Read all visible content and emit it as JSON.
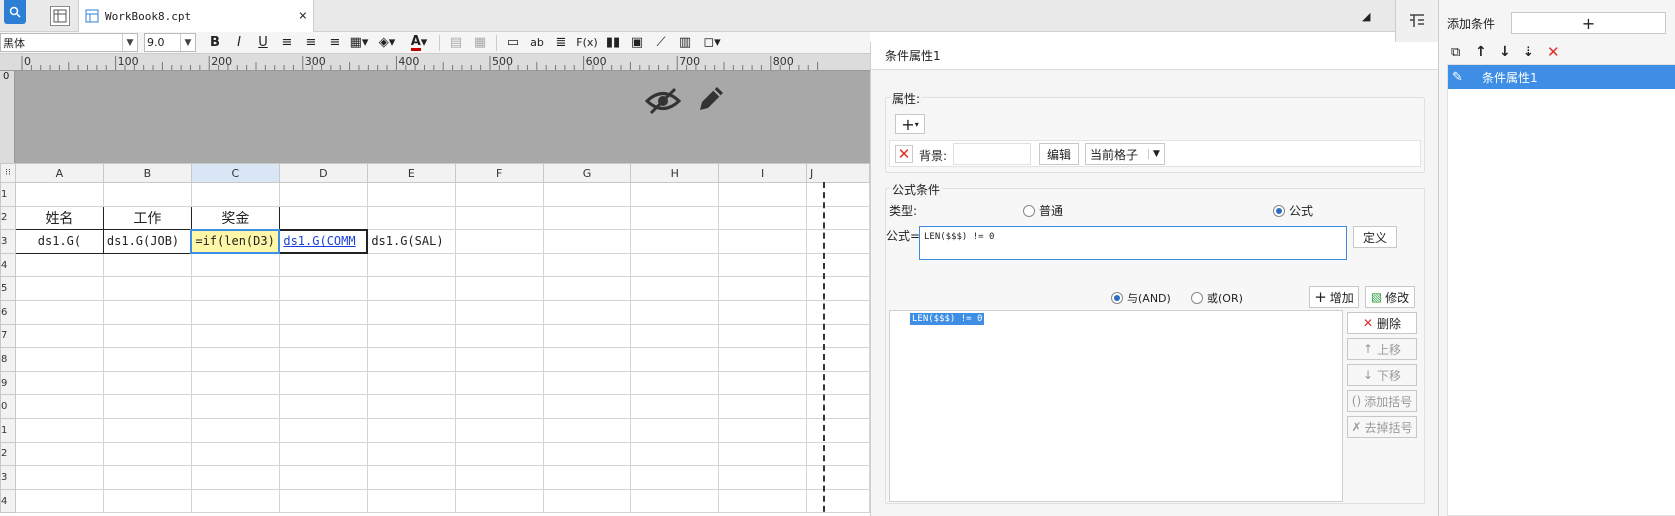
{
  "app": {
    "doc_tab": "WorkBook8.cpt"
  },
  "toolbar": {
    "font_name": "黑体",
    "font_size": "9.0",
    "bold": "B",
    "italic": "I",
    "underline": "U",
    "text_color_glyph": "A",
    "abc_glyph": "ab",
    "fx_glyph": "F(x)"
  },
  "ruler": {
    "ticks": [
      "0",
      "100",
      "200",
      "300",
      "400",
      "500",
      "600",
      "700",
      "800"
    ],
    "left_zero": "0"
  },
  "sheet": {
    "columns": [
      "A",
      "B",
      "C",
      "D",
      "E",
      "F",
      "G",
      "H",
      "I",
      "J"
    ],
    "rows": [
      "1",
      "2",
      "3",
      "4",
      "5",
      "6",
      "7",
      "8",
      "9",
      "0",
      "1",
      "2",
      "3",
      "4"
    ],
    "cells": {
      "A2": "姓名",
      "B2": "工作",
      "C2": "奖金",
      "A3": "ds1.G(",
      "B3": "ds1.G(JOB)",
      "C3": "=if(len(D3)",
      "D3": "ds1.G(COMM",
      "E3": "ds1.G(SAL)"
    }
  },
  "cond_panel": {
    "title": "条件属性1",
    "property_group_label": "属性:",
    "background_label": "背景:",
    "edit_button": "编辑",
    "scope_select": "当前格子",
    "formula_group_label": "公式条件",
    "type_label": "类型:",
    "type_normal": "普通",
    "type_formula": "公式",
    "formula_label": "公式=",
    "formula_value": "LEN($$$) != 0",
    "define_button": "定义",
    "and_label": "与(AND)",
    "or_label": "或(OR)",
    "add_button": "增加",
    "modify_button": "修改",
    "conditions": [
      "LEN($$$) != 0"
    ],
    "delete_button": "删除",
    "up_button": "上移",
    "down_button": "下移",
    "add_paren_button": "添加括号",
    "remove_paren_button": "去掉括号"
  },
  "side_panel": {
    "add_condition_label": "添加条件",
    "items": [
      "条件属性1"
    ]
  },
  "colors": {
    "accent": "#3c8de0",
    "selection": "#3d8ee4",
    "red": "#e0302a",
    "band": "#a8a8a8"
  }
}
